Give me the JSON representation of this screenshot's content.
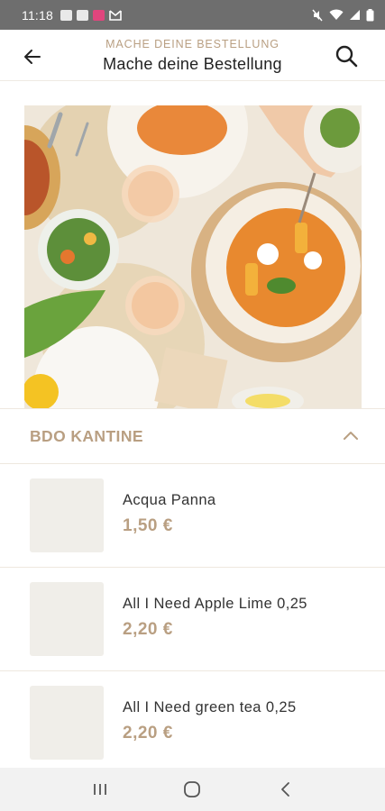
{
  "status_bar": {
    "time": "11:18",
    "left_icons": [
      "image-icon",
      "image-icon",
      "app-icon",
      "mail-icon"
    ],
    "right_icons": [
      "mute-icon",
      "wifi-icon",
      "signal-icon",
      "battery-icon"
    ]
  },
  "header": {
    "subtitle": "MACHE DEINE BESTELLUNG",
    "title": "Mache deine Bestellung",
    "back_icon": "arrow-left-icon",
    "search_icon": "search-icon"
  },
  "hero": {
    "image": "food-table-photo"
  },
  "section": {
    "title": "BDO KANTINE",
    "chevron": "chevron-up-icon"
  },
  "items": [
    {
      "name": "Acqua Panna",
      "price": "1,50 €"
    },
    {
      "name": "All I Need Apple Lime 0,25",
      "price": "2,20 €"
    },
    {
      "name": "All I Need green tea 0,25",
      "price": "2,20 €"
    }
  ],
  "nav": {
    "recent_icon": "recent-apps-icon",
    "home_icon": "home-icon",
    "back_icon": "back-icon"
  },
  "colors": {
    "accent": "#b99f82",
    "status_bar": "#6e6e6e",
    "thumb_bg": "#f0eee9",
    "divider": "#eee8df"
  }
}
